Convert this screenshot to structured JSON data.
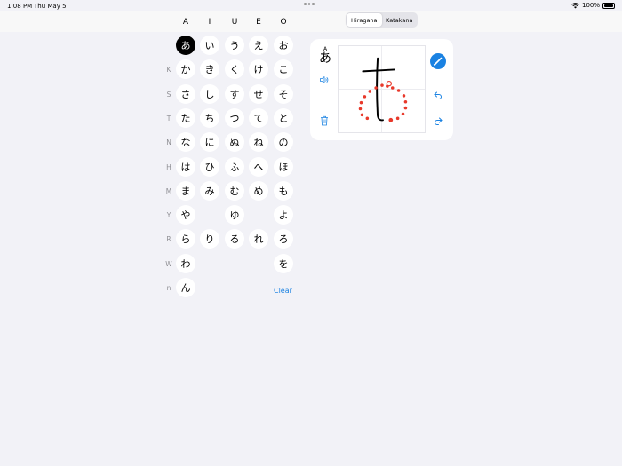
{
  "status_bar": {
    "time": "1:08 PM",
    "date": "Thu May 5",
    "battery": "100%"
  },
  "segmented": {
    "options": [
      "Hiragana",
      "Katakana"
    ],
    "selected": "Hiragana"
  },
  "columns": [
    "A",
    "I",
    "U",
    "E",
    "O"
  ],
  "rows": [
    {
      "label": "",
      "kana": [
        "あ",
        "い",
        "う",
        "え",
        "お"
      ]
    },
    {
      "label": "K",
      "kana": [
        "か",
        "き",
        "く",
        "け",
        "こ"
      ]
    },
    {
      "label": "S",
      "kana": [
        "さ",
        "し",
        "す",
        "せ",
        "そ"
      ]
    },
    {
      "label": "T",
      "kana": [
        "た",
        "ち",
        "つ",
        "て",
        "と"
      ]
    },
    {
      "label": "N",
      "kana": [
        "な",
        "に",
        "ぬ",
        "ね",
        "の"
      ]
    },
    {
      "label": "H",
      "kana": [
        "は",
        "ひ",
        "ふ",
        "へ",
        "ほ"
      ]
    },
    {
      "label": "M",
      "kana": [
        "ま",
        "み",
        "む",
        "め",
        "も"
      ]
    },
    {
      "label": "Y",
      "kana": [
        "や",
        "",
        "ゆ",
        "",
        "よ"
      ]
    },
    {
      "label": "R",
      "kana": [
        "ら",
        "り",
        "る",
        "れ",
        "ろ"
      ]
    },
    {
      "label": "W",
      "kana": [
        "わ",
        "",
        "",
        "",
        "を"
      ]
    },
    {
      "label": "n",
      "kana": [
        "ん",
        "",
        "",
        "",
        ""
      ]
    }
  ],
  "selected_kana": "あ",
  "clear_label": "Clear",
  "practice": {
    "romaji": "A",
    "kana": "あ"
  },
  "colors": {
    "accent": "#1a82e2",
    "guide": "#e8392b",
    "selected": "#000000"
  }
}
